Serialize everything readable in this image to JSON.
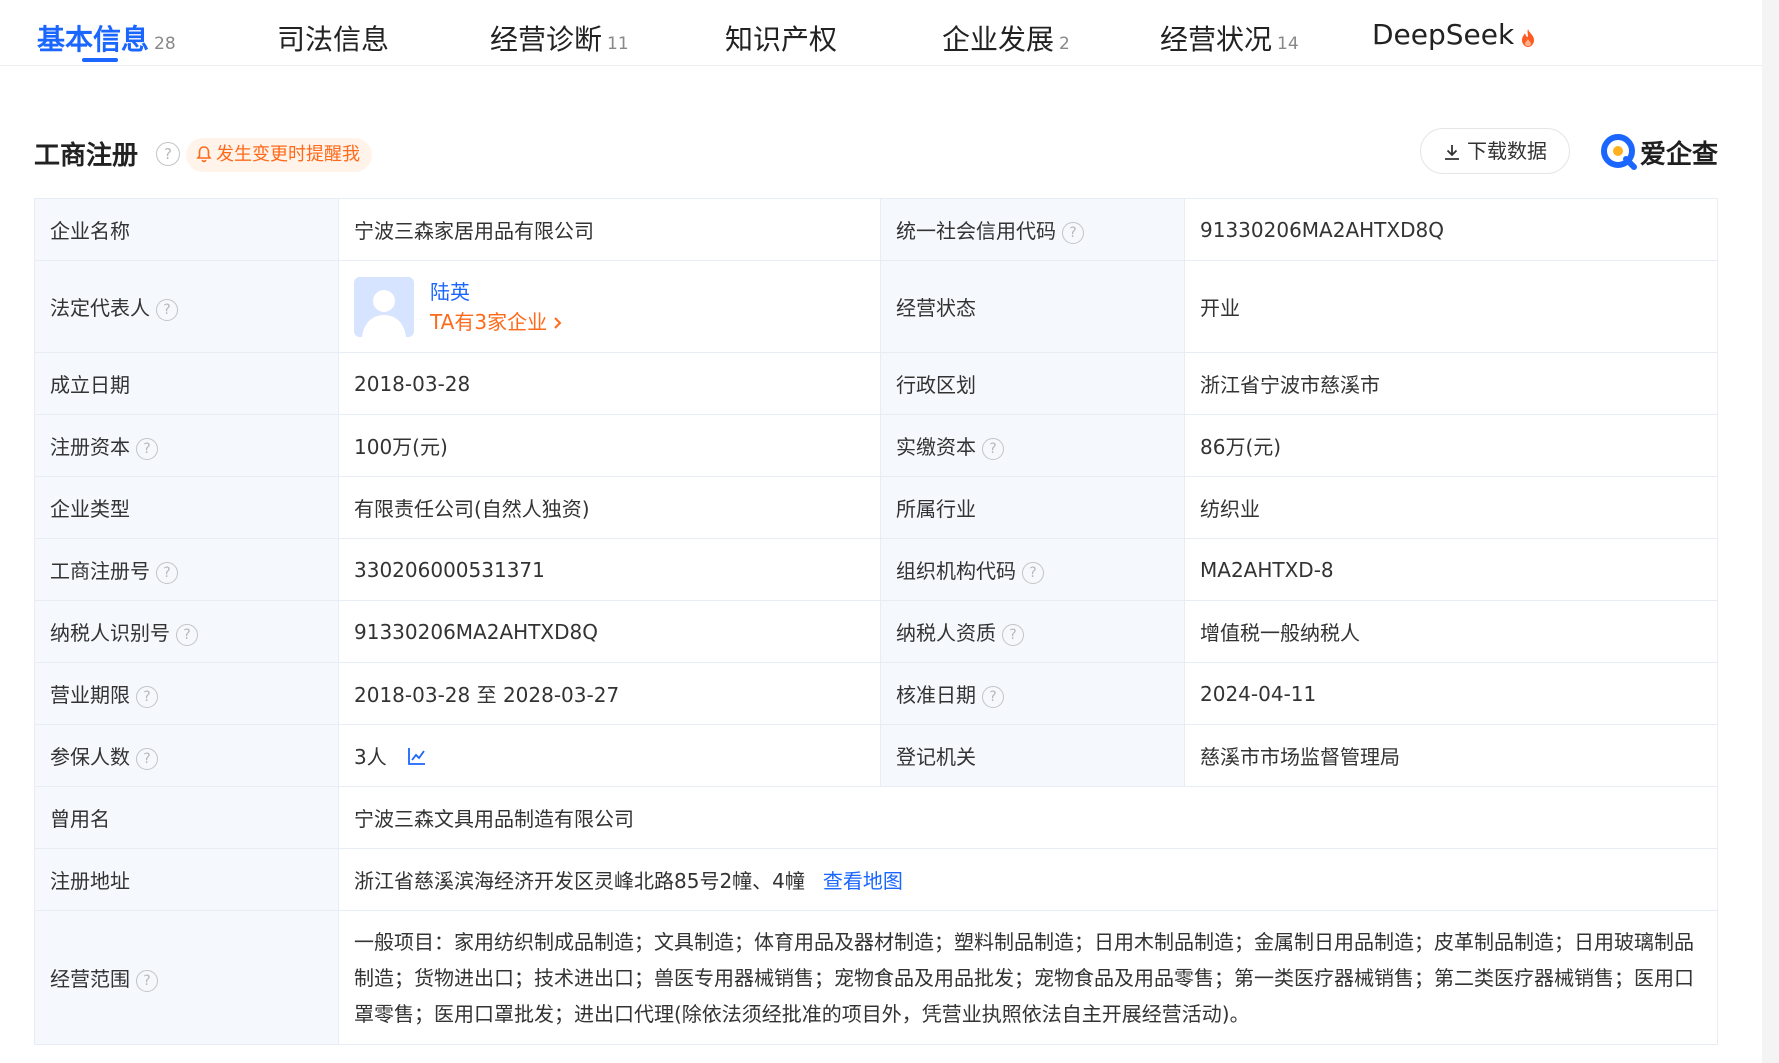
{
  "tabs": [
    {
      "label": "基本信息",
      "count": "28",
      "active": true
    },
    {
      "label": "司法信息",
      "count": ""
    },
    {
      "label": "经营诊断",
      "count": "11"
    },
    {
      "label": "知识产权",
      "count": ""
    },
    {
      "label": "企业发展",
      "count": "2"
    },
    {
      "label": "经营状况",
      "count": "14"
    },
    {
      "label": "DeepSeek",
      "count": ""
    }
  ],
  "section": {
    "title": "工商注册",
    "help": "?",
    "remind_label": "发生变更时提醒我",
    "download_label": "下载数据",
    "brand": "爱企查"
  },
  "table": {
    "company_name": {
      "label": "企业名称",
      "value": "宁波三森家居用品有限公司"
    },
    "credit_code": {
      "label": "统一社会信用代码",
      "value": "91330206MA2AHTXD8Q"
    },
    "legal_rep": {
      "label": "法定代表人",
      "name": "陆英",
      "link": "TA有3家企业"
    },
    "status": {
      "label": "经营状态",
      "value": "开业"
    },
    "founded": {
      "label": "成立日期",
      "value": "2018-03-28"
    },
    "region": {
      "label": "行政区划",
      "value": "浙江省宁波市慈溪市"
    },
    "reg_capital": {
      "label": "注册资本",
      "value": "100万(元)"
    },
    "paid_capital": {
      "label": "实缴资本",
      "value": "86万(元)"
    },
    "company_type": {
      "label": "企业类型",
      "value": "有限责任公司(自然人独资)"
    },
    "industry": {
      "label": "所属行业",
      "value": "纺织业"
    },
    "reg_no": {
      "label": "工商注册号",
      "value": "330206000531371"
    },
    "org_code": {
      "label": "组织机构代码",
      "value": "MA2AHTXD-8"
    },
    "tax_id": {
      "label": "纳税人识别号",
      "value": "91330206MA2AHTXD8Q"
    },
    "tax_qual": {
      "label": "纳税人资质",
      "value": "增值税一般纳税人"
    },
    "term": {
      "label": "营业期限",
      "value": "2018-03-28 至 2028-03-27"
    },
    "approve_date": {
      "label": "核准日期",
      "value": "2024-04-11"
    },
    "insured": {
      "label": "参保人数",
      "value": "3人"
    },
    "authority": {
      "label": "登记机关",
      "value": "慈溪市市场监督管理局"
    },
    "former_name": {
      "label": "曾用名",
      "value": "宁波三森文具用品制造有限公司"
    },
    "address": {
      "label": "注册地址",
      "value": "浙江省慈溪滨海经济开发区灵峰北路85号2幢、4幢",
      "map_link": "查看地图"
    },
    "scope": {
      "label": "经营范围",
      "value": "一般项目：家用纺织制成品制造；文具制造；体育用品及器材制造；塑料制品制造；日用木制品制造；金属制日用品制造；皮革制品制造；日用玻璃制品制造；货物进出口；技术进出口；兽医专用器械销售；宠物食品及用品批发；宠物食品及用品零售；第一类医疗器械销售；第二类医疗器械销售；医用口罩零售；医用口罩批发；进出口代理(除依法须经批准的项目外，凭营业执照依法自主开展经营活动)。"
    }
  },
  "colors": {
    "accent": "#1a66ff",
    "orange": "#ff6a1a",
    "label_bg": "#f5f8fc",
    "border": "#e7ecf5"
  },
  "icons": [
    "help-icon",
    "bell-icon",
    "download-icon",
    "brand-logo-icon",
    "chevron-right-icon",
    "trend-chart-icon",
    "flame-icon"
  ]
}
